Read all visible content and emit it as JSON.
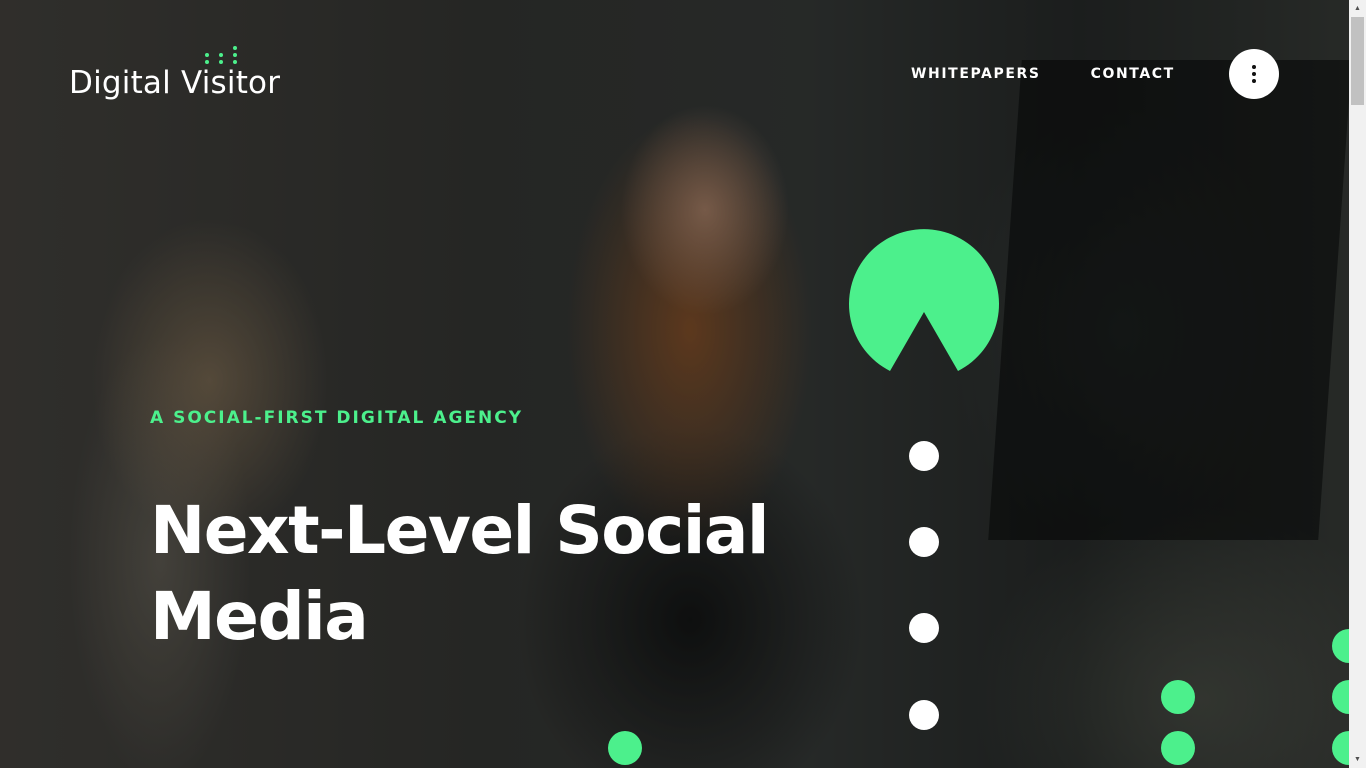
{
  "brand": {
    "logo_text": "Digital Visitor",
    "accent_color": "#4cf08c"
  },
  "nav": {
    "items": [
      {
        "label": "WHITEPAPERS"
      },
      {
        "label": "CONTACT"
      }
    ],
    "menu_icon": "kebab-menu-icon"
  },
  "hero": {
    "eyebrow": "A SOCIAL-FIRST DIGITAL AGENCY",
    "headline": "Next-Level Social Media"
  },
  "icons": {
    "pacman": "pacman-icon",
    "dots": "dot-icon"
  }
}
